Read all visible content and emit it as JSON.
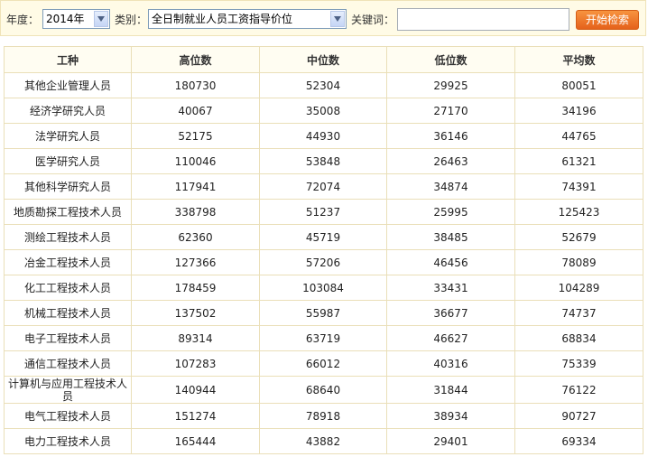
{
  "filters": {
    "year_label": "年度：",
    "year_value": "2014年",
    "category_label": "类别：",
    "category_value": "全日制就业人员工资指导价位",
    "keyword_label": "关键词：",
    "keyword_value": "",
    "search_button": "开始检索"
  },
  "table": {
    "headers": [
      "工种",
      "高位数",
      "中位数",
      "低位数",
      "平均数"
    ],
    "rows": [
      [
        "其他企业管理人员",
        "180730",
        "52304",
        "29925",
        "80051"
      ],
      [
        "经济学研究人员",
        "40067",
        "35008",
        "27170",
        "34196"
      ],
      [
        "法学研究人员",
        "52175",
        "44930",
        "36146",
        "44765"
      ],
      [
        "医学研究人员",
        "110046",
        "53848",
        "26463",
        "61321"
      ],
      [
        "其他科学研究人员",
        "117941",
        "72074",
        "34874",
        "74391"
      ],
      [
        "地质勘探工程技术人员",
        "338798",
        "51237",
        "25995",
        "125423"
      ],
      [
        "测绘工程技术人员",
        "62360",
        "45719",
        "38485",
        "52679"
      ],
      [
        "冶金工程技术人员",
        "127366",
        "57206",
        "46456",
        "78089"
      ],
      [
        "化工工程技术人员",
        "178459",
        "103084",
        "33431",
        "104289"
      ],
      [
        "机械工程技术人员",
        "137502",
        "55987",
        "36677",
        "74737"
      ],
      [
        "电子工程技术人员",
        "89314",
        "63719",
        "46627",
        "68834"
      ],
      [
        "通信工程技术人员",
        "107283",
        "66012",
        "40316",
        "75339"
      ],
      [
        "计算机与应用工程技术人员",
        "140944",
        "68640",
        "31844",
        "76122"
      ],
      [
        "电气工程技术人员",
        "151274",
        "78918",
        "38934",
        "90727"
      ],
      [
        "电力工程技术人员",
        "165444",
        "43882",
        "29401",
        "69334"
      ]
    ]
  }
}
